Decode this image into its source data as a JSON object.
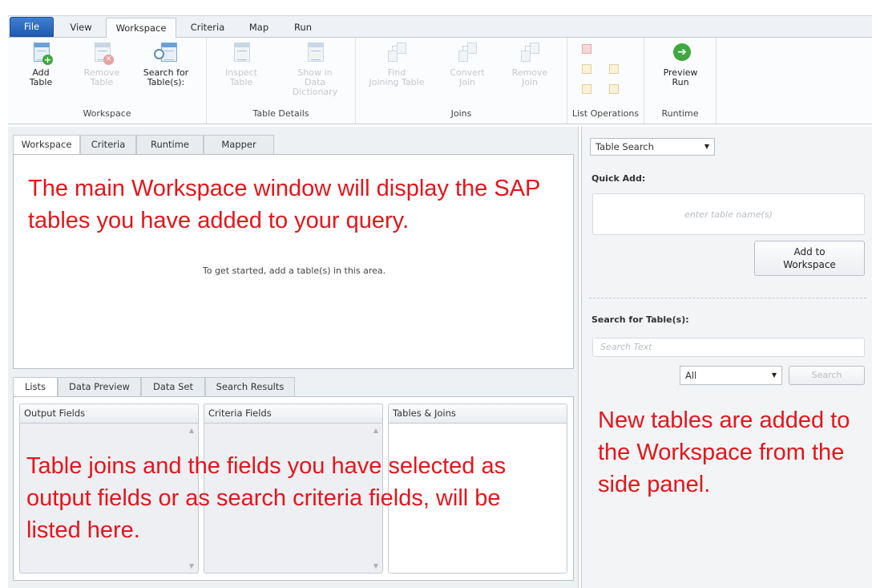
{
  "ribbon_tabs": [
    "File",
    "View",
    "Workspace",
    "Criteria",
    "Map",
    "Run"
  ],
  "ribbon": {
    "workspace_group": {
      "label": "Workspace",
      "add_table": "Add\nTable",
      "remove_table": "Remove\nTable",
      "search_tables": "Search for\nTable(s):"
    },
    "table_details_group": {
      "label": "Table Details",
      "inspect_table": "Inspect\nTable",
      "show_in_dictionary": "Show in\nData Dictionary"
    },
    "joins_group": {
      "label": "Joins",
      "find_joining_table": "Find\nJoining Table",
      "convert_join": "Convert\nJoin",
      "remove_join": "Remove\nJoin"
    },
    "list_operations_group": {
      "label": "List Operations"
    },
    "runtime_group": {
      "label": "Runtime",
      "preview_run": "Preview\nRun"
    }
  },
  "workspace_tabs": [
    "Workspace",
    "Criteria",
    "Runtime",
    "Mapper"
  ],
  "workspace_pane": {
    "annotation": "The main Workspace window will display the SAP tables you have added to your query.",
    "hint": "To get started, add a table(s) in this area."
  },
  "bottom_tabs": [
    "Lists",
    "Data Preview",
    "Data Set",
    "Search Results"
  ],
  "list_columns": [
    "Output Fields",
    "Criteria Fields",
    "Tables & Joins"
  ],
  "lists_annotation": "Table joins and the fields you have selected as output fields or as search criteria fields, will be listed here.",
  "side_panel": {
    "mode_select": "Table Search",
    "quick_add_label": "Quick Add:",
    "quick_add_placeholder": "enter table name(s)",
    "add_to_workspace": "Add to\nWorkspace",
    "search_label": "Search for Table(s):",
    "search_placeholder": "Search Text",
    "filter_select": "All",
    "search_button": "Search",
    "annotation": "New tables are added to the Workspace from the side panel."
  }
}
